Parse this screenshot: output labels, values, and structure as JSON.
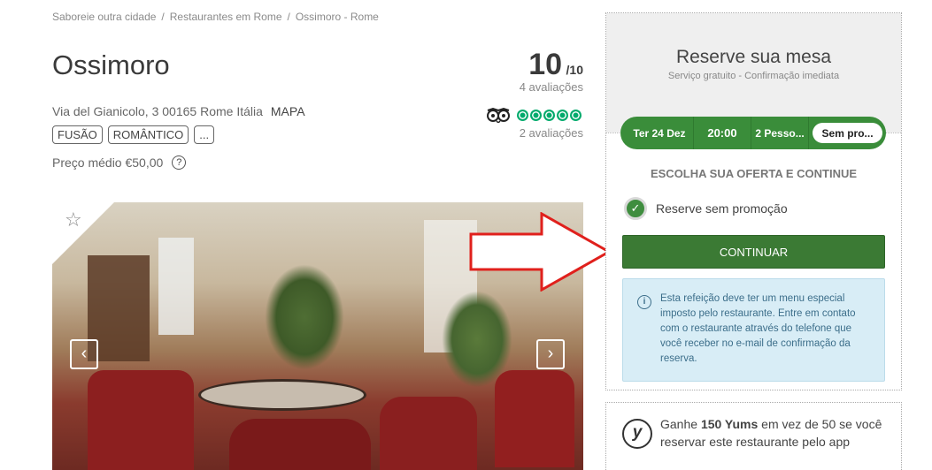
{
  "breadcrumb": [
    {
      "label": "Saboreie outra cidade"
    },
    {
      "label": "Restaurantes em Rome"
    },
    {
      "label": "Ossimoro - Rome"
    }
  ],
  "breadcrumb_sep": "/",
  "restaurant": {
    "name": "Ossimoro",
    "address": "Via del Gianicolo, 3 00165 Rome Itália",
    "map_label": "MAPA",
    "tags": [
      "FUSÃO",
      "ROMÂNTICO",
      "..."
    ],
    "avg_price": "Preço médio €50,00",
    "help_icon_glyph": "?"
  },
  "rating": {
    "score": "10",
    "denominator": "/10",
    "reviews": "4 avaliações",
    "tripadvisor_bubbles": 5,
    "tripadvisor_reviews": "2 avaliações"
  },
  "gallery": {
    "favorite_icon": "star-outline-icon",
    "prev_glyph": "‹",
    "next_glyph": "›"
  },
  "booking": {
    "title": "Reserve sua mesa",
    "subtitle": "Serviço gratuito - Confirmação imediata",
    "date": "Ter 24 Dez",
    "time": "20:00",
    "people": "2 Pesso...",
    "offer_select": "Sem pro...",
    "offer_heading": "ESCOLHA SUA OFERTA E CONTINUE",
    "offer_option": "Reserve sem promoção",
    "continue_label": "CONTINUAR",
    "info_text": "Esta refeição deve ter um menu especial imposto pelo restaurante. Entre em contato com o restaurante através do telefone que você receber no e-mail de confirmação da reserva."
  },
  "yums": {
    "logo": "y",
    "text_prefix": "Ganhe ",
    "text_bold": "150 Yums",
    "text_suffix": " em vez de 50 se você reservar este restaurante pelo app"
  },
  "colors": {
    "brand_green": "#3a8d3a",
    "button_green": "#3b7a34",
    "tripadvisor_green": "#00aa6c",
    "info_bg": "#d8edf6",
    "annotation_arrow": "#e0201c"
  }
}
